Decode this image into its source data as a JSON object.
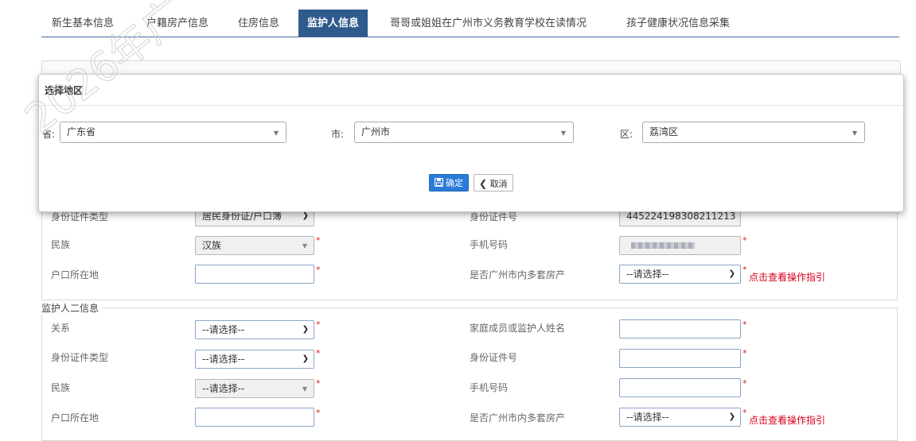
{
  "tabs": [
    {
      "label": "新生基本信息"
    },
    {
      "label": "户籍房产信息"
    },
    {
      "label": "住房信息"
    },
    {
      "label": "监护人信息",
      "active": true
    },
    {
      "label": "哥哥或姐姐在广州市义务教育学校在读情况"
    },
    {
      "label": "孩子健康状况信息采集"
    }
  ],
  "watermark": {
    "text": "2026年广"
  },
  "modal": {
    "title": "选择地区",
    "province_label": "省:",
    "province_value": "广东省",
    "city_label": "市:",
    "city_value": "广州市",
    "district_label": "区:",
    "district_value": "荔湾区",
    "confirm_label": "确定",
    "cancel_label": "取消"
  },
  "guardian1": {
    "id_type_label": "身份证件类型",
    "id_type_value": "居民身份证/户口簿",
    "id_number_label": "身份证件号",
    "id_number_value": "445224198308211213",
    "ethnicity_label": "民族",
    "ethnicity_value": "汉族",
    "phone_label": "手机号码",
    "hukou_label": "户口所在地",
    "multi_house_label": "是否广州市内多套房产",
    "multi_house_value": "--请选择--",
    "guide_link": "点击查看操作指引"
  },
  "guardian2": {
    "section_title": "监护人二信息",
    "relation_label": "关系",
    "relation_value": "--请选择--",
    "name_label": "家庭成员或监护人姓名",
    "id_type_label": "身份证件类型",
    "id_type_value": "--请选择--",
    "id_number_label": "身份证件号",
    "ethnicity_label": "民族",
    "ethnicity_value": "--请选择--",
    "phone_label": "手机号码",
    "hukou_label": "户口所在地",
    "multi_house_label": "是否广州市内多套房产",
    "multi_house_value": "--请选择--",
    "guide_link": "点击查看操作指引"
  },
  "required_mark": "*",
  "colors": {
    "tab_active_bg": "#2f5a8e",
    "primary_button": "#2a7ad8",
    "required": "#e02020",
    "guide_link": "#d9001b"
  }
}
